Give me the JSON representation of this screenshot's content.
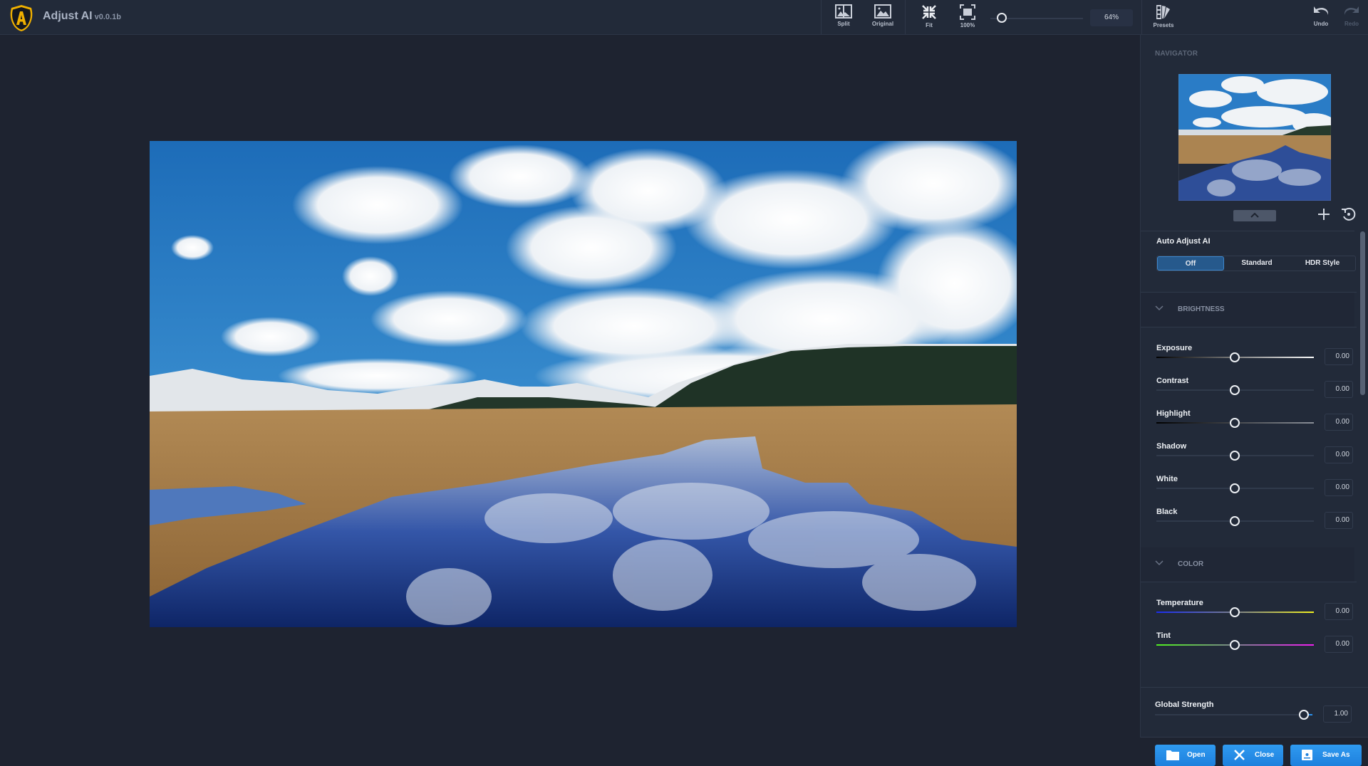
{
  "app": {
    "title": "Adjust AI",
    "version": "v0.0.1b"
  },
  "toolbar": {
    "split_label": "Split",
    "original_label": "Original",
    "fit_label": "Fit",
    "actual_label": "100%",
    "zoom_percent": "64%",
    "zoom_slider_fraction": 0.12,
    "presets_label": "Presets",
    "undo_label": "Undo",
    "redo_label": "Redo"
  },
  "navigator": {
    "title": "NAVIGATOR"
  },
  "auto_adjust": {
    "title": "Auto Adjust AI",
    "options": [
      "Off",
      "Standard",
      "HDR Style"
    ],
    "selected": "Off"
  },
  "brightness": {
    "title": "BRIGHTNESS",
    "controls": [
      {
        "name": "Exposure",
        "value": "0.00",
        "fraction": 0.5
      },
      {
        "name": "Contrast",
        "value": "0.00",
        "fraction": 0.5
      },
      {
        "name": "Highlight",
        "value": "0.00",
        "fraction": 0.5
      },
      {
        "name": "Shadow",
        "value": "0.00",
        "fraction": 0.5
      },
      {
        "name": "White",
        "value": "0.00",
        "fraction": 0.5
      },
      {
        "name": "Black",
        "value": "0.00",
        "fraction": 0.5
      }
    ]
  },
  "color": {
    "title": "COLOR",
    "controls": [
      {
        "name": "Temperature",
        "value": "0.00",
        "fraction": 0.5
      },
      {
        "name": "Tint",
        "value": "0.00",
        "fraction": 0.5
      }
    ]
  },
  "global_strength": {
    "name": "Global Strength",
    "value": "1.00",
    "fraction": 0.95
  },
  "actions": {
    "open_label": "Open",
    "close_label": "Close",
    "save_as_label": "Save As"
  },
  "colors": {
    "accent": "#2a8fea",
    "segment_active": "#26598c",
    "logo": "#f0b000"
  }
}
